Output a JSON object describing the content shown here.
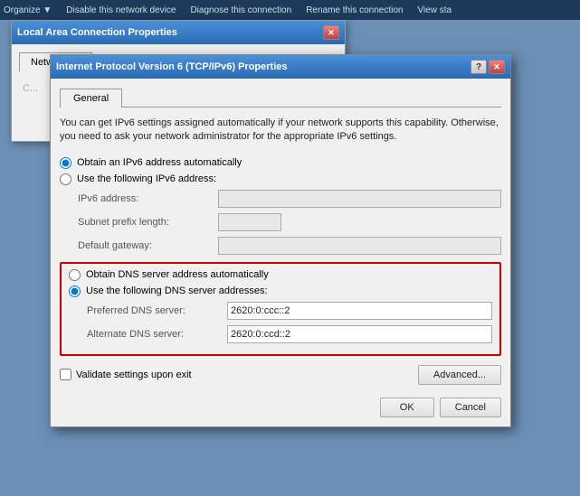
{
  "taskbar": {
    "items": [
      "Organize ▼",
      "Disable this network device",
      "Diagnose this connection",
      "Rename this connection",
      "View sta"
    ]
  },
  "bg_window": {
    "title": "Local Area Connection Properties",
    "close_btn": "✕",
    "tab": "Networking"
  },
  "dialog": {
    "title": "Internet Protocol Version 6 (TCP/IPv6) Properties",
    "help_btn": "?",
    "close_btn": "✕",
    "tab": "General",
    "info_text": "You can get IPv6 settings assigned automatically if your network supports this capability. Otherwise, you need to ask your network administrator for the appropriate IPv6 settings.",
    "auto_address_label": "Obtain an IPv6 address automatically",
    "manual_address_label": "Use the following IPv6 address:",
    "ipv6_address_label": "IPv6 address:",
    "ipv6_address_value": "",
    "subnet_label": "Subnet prefix length:",
    "subnet_value": "",
    "gateway_label": "Default gateway:",
    "gateway_value": "",
    "auto_dns_label": "Obtain DNS server address automatically",
    "manual_dns_label": "Use the following DNS server addresses:",
    "preferred_dns_label": "Preferred DNS server:",
    "preferred_dns_value": "2620:0:ccc::2",
    "alternate_dns_label": "Alternate DNS server:",
    "alternate_dns_value": "2620:0:ccd::2",
    "validate_label": "Validate settings upon exit",
    "advanced_btn": "Advanced...",
    "ok_btn": "OK",
    "cancel_btn": "Cancel"
  }
}
